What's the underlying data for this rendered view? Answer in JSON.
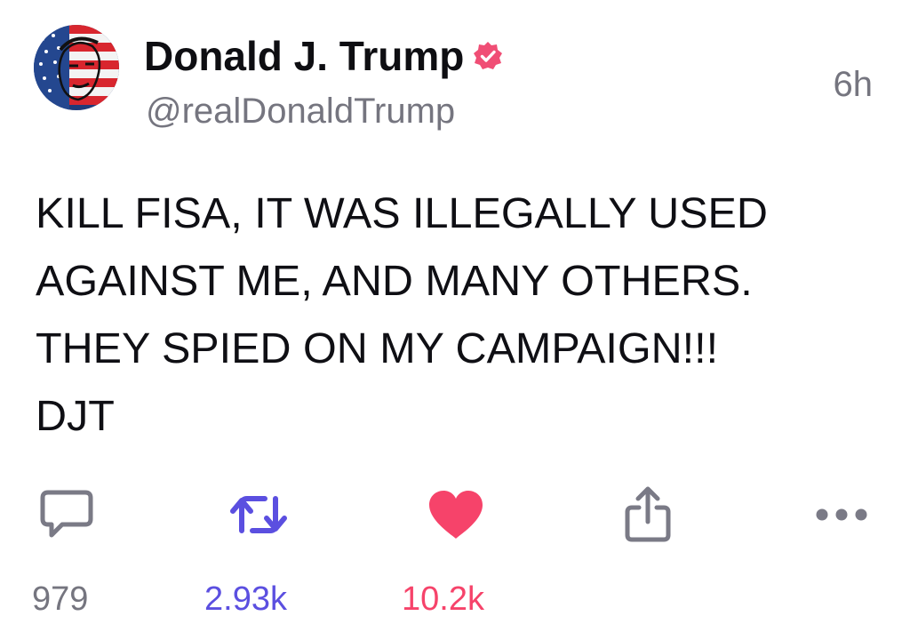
{
  "author": {
    "display_name": "Donald J. Trump",
    "handle": "@realDonaldTrump",
    "verified_icon": "verified-badge-icon",
    "avatar_icon": "flag-portrait-avatar"
  },
  "timestamp": "6h",
  "body": "KILL FISA, IT WAS ILLEGALLY USED\nAGAINST ME, AND MANY OTHERS.\nTHEY SPIED ON MY CAMPAIGN!!!\nDJT",
  "actions": {
    "reply": {
      "icon": "reply-bubble-icon",
      "count": "979"
    },
    "repost": {
      "icon": "repost-icon",
      "count": "2.93k",
      "color": "#5b4fe0"
    },
    "like": {
      "icon": "heart-icon",
      "count": "10.2k",
      "color": "#f6436a"
    },
    "share": {
      "icon": "share-icon"
    },
    "more": {
      "icon": "more-dots-icon"
    }
  },
  "colors": {
    "text": "#0f0f14",
    "muted": "#75757f",
    "icon_gray": "#7a7a86",
    "verified": "#f04e75",
    "repost_active": "#5b4fe0",
    "like_active": "#f6436a"
  }
}
